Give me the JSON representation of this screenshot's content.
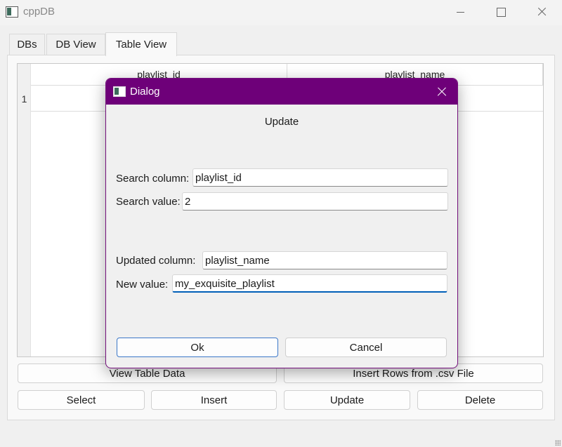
{
  "window": {
    "title": "cppDB",
    "icon": "app-window-icon"
  },
  "tabs": [
    {
      "label": "DBs"
    },
    {
      "label": "DB View"
    },
    {
      "label": "Table View"
    }
  ],
  "table": {
    "columns": [
      "playlist_id",
      "playlist_name"
    ],
    "row_headers": [
      "1"
    ]
  },
  "buttons": {
    "view_table_data": "View Table Data",
    "insert_csv": "Insert Rows from .csv File",
    "select": "Select",
    "insert": "Insert",
    "update": "Update",
    "delete": "Delete"
  },
  "dialog": {
    "title": "Dialog",
    "heading": "Update",
    "search_column_label": "Search column:",
    "search_column_value": "playlist_id",
    "search_value_label": "Search value:",
    "search_value_value": "2",
    "updated_column_label": "Updated column:",
    "updated_column_value": "playlist_name",
    "new_value_label": "New value:",
    "new_value_value": "my_exquisite_playlist",
    "ok_label": "Ok",
    "cancel_label": "Cancel",
    "accent_color": "#6e0079"
  }
}
